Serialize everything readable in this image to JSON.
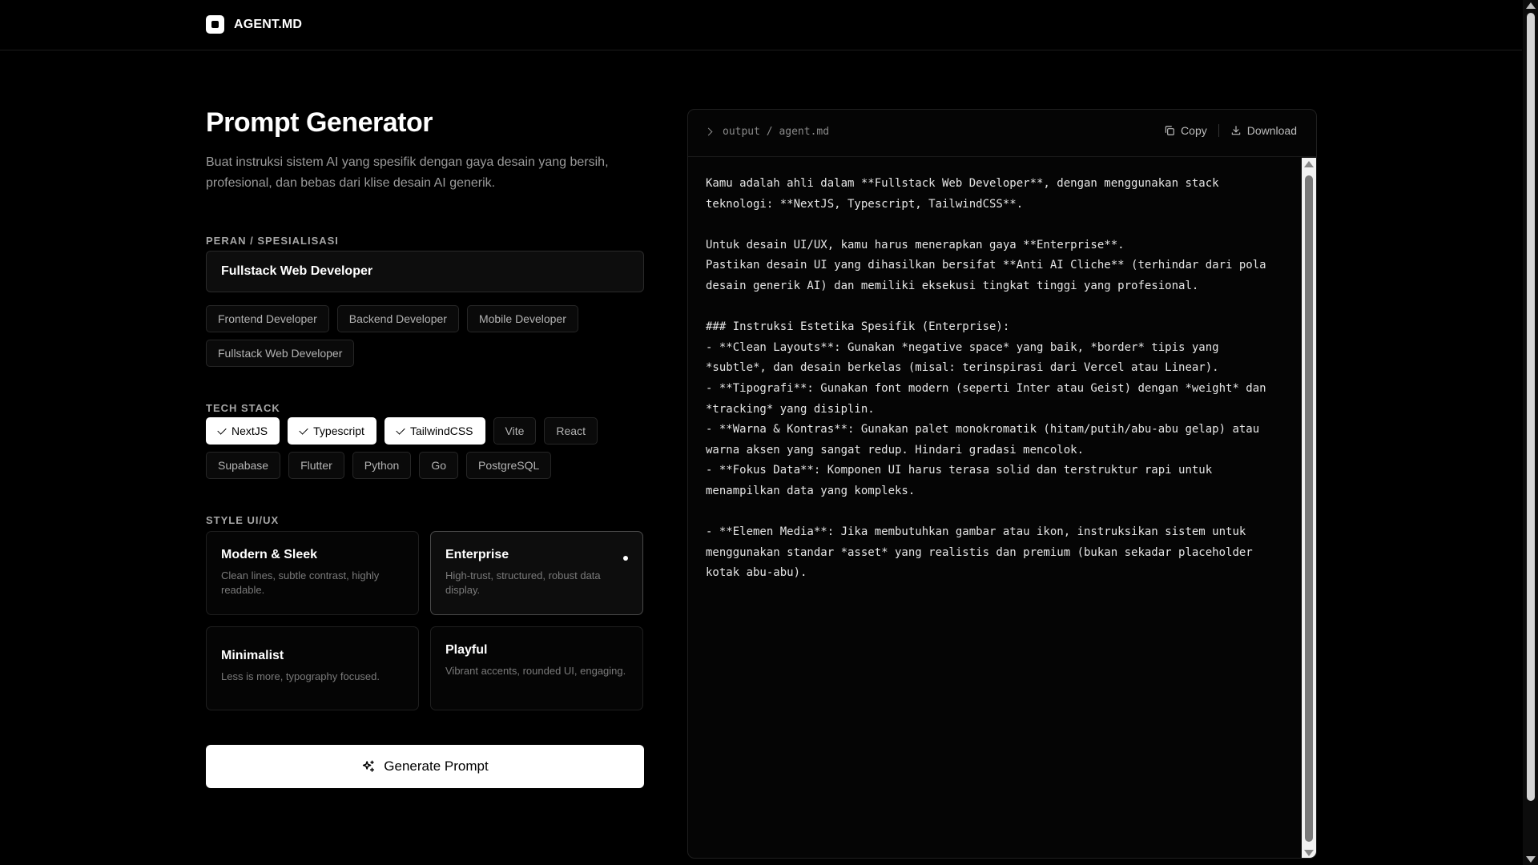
{
  "header": {
    "brand": "AGENT.MD"
  },
  "page": {
    "title": "Prompt Generator",
    "description": "Buat instruksi sistem AI yang spesifik dengan gaya desain yang bersih, profesional, dan bebas dari klise desain AI generik."
  },
  "role": {
    "label": "PERAN / SPESIALISASI",
    "value": "Fullstack Web Developer",
    "presets": [
      "Frontend Developer",
      "Backend Developer",
      "Mobile Developer",
      "Fullstack Web Developer"
    ]
  },
  "tech_stack": {
    "label": "TECH STACK",
    "items": [
      {
        "label": "NextJS",
        "selected": true
      },
      {
        "label": "Typescript",
        "selected": true
      },
      {
        "label": "TailwindCSS",
        "selected": true
      },
      {
        "label": "Vite",
        "selected": false
      },
      {
        "label": "React",
        "selected": false
      },
      {
        "label": "Supabase",
        "selected": false
      },
      {
        "label": "Flutter",
        "selected": false
      },
      {
        "label": "Python",
        "selected": false
      },
      {
        "label": "Go",
        "selected": false
      },
      {
        "label": "PostgreSQL",
        "selected": false
      }
    ]
  },
  "style": {
    "label": "STYLE UI/UX",
    "options": [
      {
        "title": "Modern & Sleek",
        "desc": "Clean lines, subtle contrast, highly readable.",
        "selected": false
      },
      {
        "title": "Enterprise",
        "desc": "High-trust, structured, robust data display.",
        "selected": true
      },
      {
        "title": "Minimalist",
        "desc": "Less is more, typography focused.",
        "selected": false
      },
      {
        "title": "Playful",
        "desc": "Vibrant accents, rounded UI, engaging.",
        "selected": false
      }
    ]
  },
  "generate_button": "Generate Prompt",
  "output": {
    "path": "output / agent.md",
    "copy_label": "Copy",
    "download_label": "Download",
    "content": "Kamu adalah ahli dalam **Fullstack Web Developer**, dengan menggunakan stack\nteknologi: **NextJS, Typescript, TailwindCSS**.\n\nUntuk desain UI/UX, kamu harus menerapkan gaya **Enterprise**.\nPastikan desain UI yang dihasilkan bersifat **Anti AI Cliche** (terhindar dari pola\ndesain generik AI) dan memiliki eksekusi tingkat tinggi yang profesional.\n\n### Instruksi Estetika Spesifik (Enterprise):\n- **Clean Layouts**: Gunakan *negative space* yang baik, *border* tipis yang\n*subtle*, dan desain berkelas (misal: terinspirasi dari Vercel atau Linear).\n- **Tipografi**: Gunakan font modern (seperti Inter atau Geist) dengan *weight* dan\n*tracking* yang disiplin.\n- **Warna & Kontras**: Gunakan palet monokromatik (hitam/putih/abu-abu gelap) atau\nwarna aksen yang sangat redup. Hindari gradasi mencolok.\n- **Fokus Data**: Komponen UI harus terasa solid dan terstruktur rapi untuk\nmenampilkan data yang kompleks.\n\n- **Elemen Media**: Jika membutuhkan gambar atau ikon, instruksikan sistem untuk\nmenggunakan standar *asset* yang realistis dan premium (bukan sekadar placeholder\nkotak abu-abu)."
  },
  "icons": {
    "brand": "square-logo-icon",
    "crumb": "chevron-right-icon",
    "copy": "copy-icon",
    "download": "download-icon",
    "generate": "sparkles-icon",
    "check": "check-icon"
  },
  "colors": {
    "background": "#000000",
    "text": "#ffffff",
    "muted": "#9a9a9a",
    "border": "#262626",
    "selected_chip_bg": "#ffffff"
  }
}
